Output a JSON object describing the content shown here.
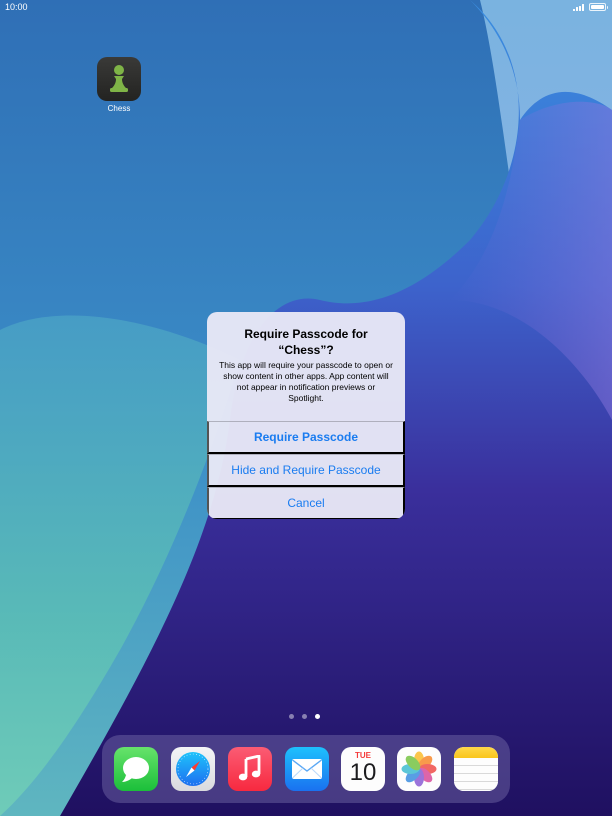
{
  "status_bar": {
    "time": "10:00"
  },
  "home_screen": {
    "apps": [
      {
        "label": "Chess",
        "icon": "chess-pawn-icon"
      }
    ],
    "page_dots": {
      "count": 3,
      "active_index": 2
    }
  },
  "alert": {
    "title": "Require Passcode for “Chess”?",
    "message": "This app will require your passcode to open or show content in other apps. App content will not appear in notification previews or Spotlight.",
    "buttons": {
      "require": "Require Passcode",
      "hide_and_require": "Hide and Require Passcode",
      "cancel": "Cancel"
    },
    "button_color": "#1a7cf0"
  },
  "dock": {
    "apps": [
      {
        "name": "Messages",
        "icon": "messages-icon"
      },
      {
        "name": "Safari",
        "icon": "safari-icon"
      },
      {
        "name": "Music",
        "icon": "music-icon"
      },
      {
        "name": "Mail",
        "icon": "mail-icon"
      },
      {
        "name": "Calendar",
        "icon": "calendar-icon",
        "day": "TUE",
        "date": "10"
      },
      {
        "name": "Photos",
        "icon": "photos-icon"
      },
      {
        "name": "Notes",
        "icon": "notes-icon"
      }
    ]
  }
}
